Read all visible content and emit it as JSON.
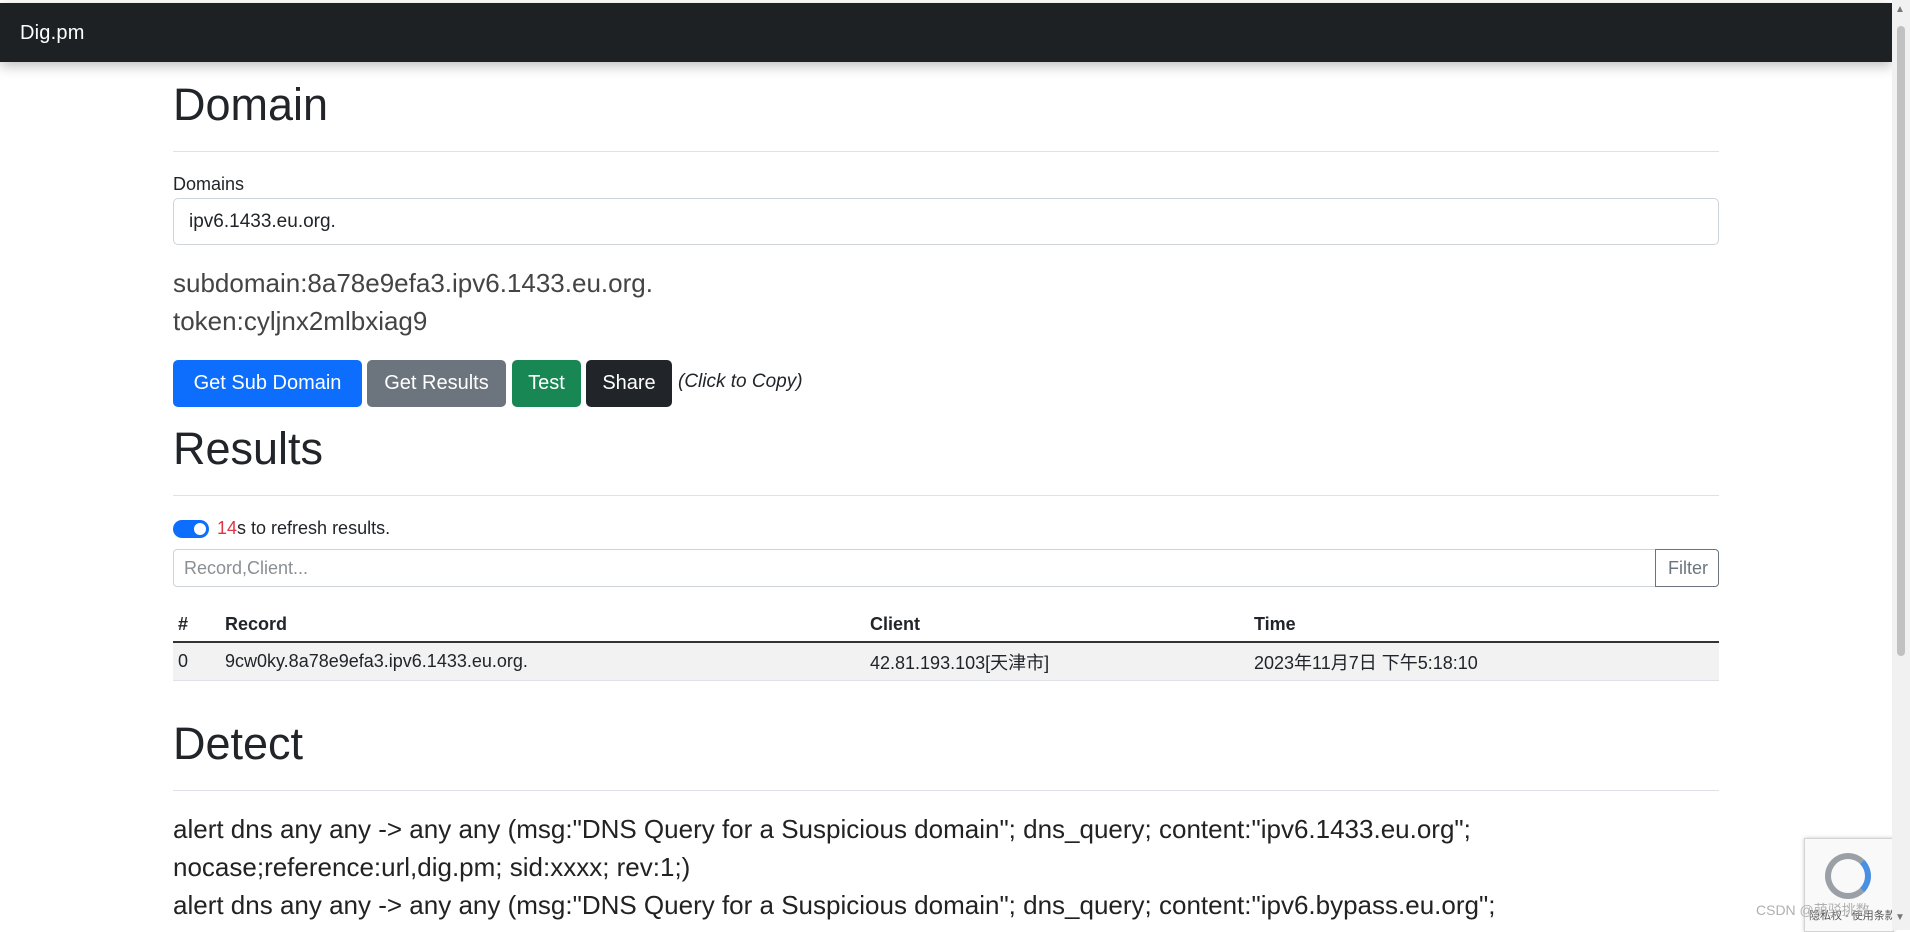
{
  "navbar": {
    "brand": "Dig.pm"
  },
  "domain_section": {
    "title": "Domain",
    "domains_label": "Domains",
    "domains_value": "ipv6.1433.eu.org.",
    "subdomain_line": "subdomain:8a78e9efa3.ipv6.1433.eu.org.",
    "token_line": "token:cyljnx2mlbxiag9"
  },
  "actions": {
    "get_sub_domain": "Get Sub Domain",
    "get_results": "Get Results",
    "test": "Test",
    "share": "Share",
    "copy_hint": "(Click to Copy)"
  },
  "results_section": {
    "title": "Results",
    "refresh_count": "14",
    "refresh_text": "s to refresh results.",
    "filter_placeholder": "Record,Client...",
    "filter_button": "Filter",
    "columns": [
      "#",
      "Record",
      "Client",
      "Time"
    ],
    "rows": [
      [
        "0",
        "9cw0ky.8a78e9efa3.ipv6.1433.eu.org.",
        "42.81.193.103[天津市]",
        "2023年11月7日 下午5:18:10"
      ]
    ]
  },
  "detect_section": {
    "title": "Detect",
    "lines": [
      "alert dns any any -> any any (msg:\"DNS Query for a Suspicious domain\"; dns_query; content:\"ipv6.1433.eu.org\";",
      "nocase;reference:url,dig.pm; sid:xxxx; rev:1;)",
      "alert dns any any -> any any (msg:\"DNS Query for a Suspicious domain\"; dns_query; content:\"ipv6.bypass.eu.org\";"
    ]
  },
  "recaptcha": {
    "links": "隐私权 - 使用条款"
  },
  "watermark": "CSDN @萌驳挑数"
}
